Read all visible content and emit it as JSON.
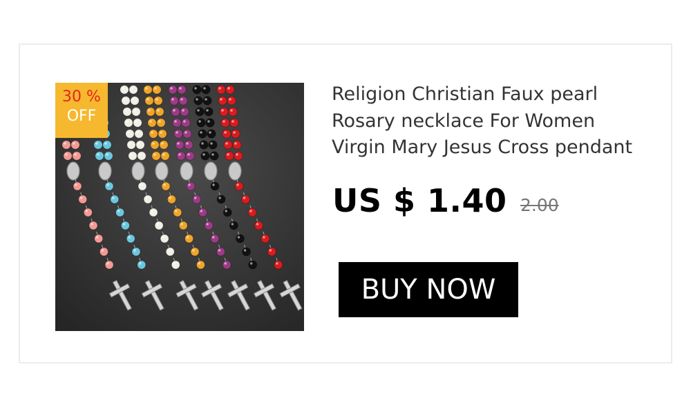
{
  "product": {
    "title_lines": [
      "Religion Christian Faux pearl",
      "Rosary necklace For Women",
      "Virgin Mary Jesus Cross pendant"
    ],
    "price": "US $ 1.40",
    "old_price": "2.00",
    "image_icon": "rosary-necklaces-photo"
  },
  "badge": {
    "percent": "30 %",
    "off": "OFF"
  },
  "buy_button": {
    "label": "BUY NOW"
  },
  "colors": {
    "badge_background": "#f5b82e",
    "badge_percent": "#e3261f",
    "button_background": "#000000",
    "bead_colors": [
      "#f29a93",
      "#6cc7de",
      "#f1efe6",
      "#f0a52a",
      "#9c3b86",
      "#111111",
      "#d91c1f"
    ]
  }
}
